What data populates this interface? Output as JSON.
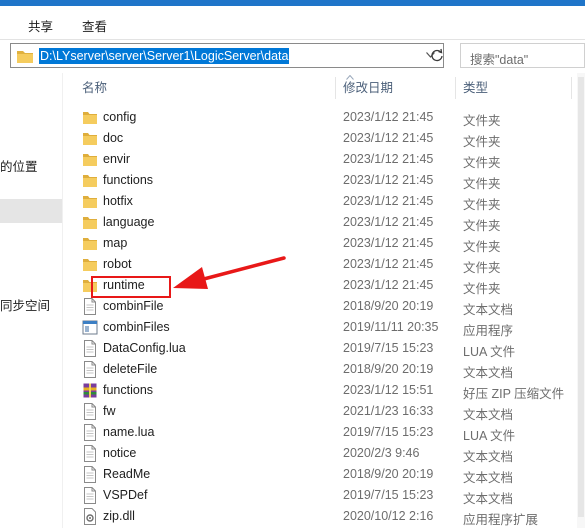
{
  "ribbon": {
    "tabs": [
      "共享",
      "查看"
    ]
  },
  "address": {
    "path": "D:\\LYserver\\server\\Server1\\LogicServer\\data"
  },
  "search": {
    "placeholder": "搜索\"data\""
  },
  "nav": {
    "items": [
      "的位置",
      "同步空间"
    ]
  },
  "columns": {
    "name": "名称",
    "date": "修改日期",
    "type": "类型"
  },
  "files": [
    {
      "name": "config",
      "date": "2023/1/12 21:45",
      "type": "文件夹",
      "icon": "folder-icon"
    },
    {
      "name": "doc",
      "date": "2023/1/12 21:45",
      "type": "文件夹",
      "icon": "folder-icon"
    },
    {
      "name": "envir",
      "date": "2023/1/12 21:45",
      "type": "文件夹",
      "icon": "folder-icon"
    },
    {
      "name": "functions",
      "date": "2023/1/12 21:45",
      "type": "文件夹",
      "icon": "folder-icon"
    },
    {
      "name": "hotfix",
      "date": "2023/1/12 21:45",
      "type": "文件夹",
      "icon": "folder-icon"
    },
    {
      "name": "language",
      "date": "2023/1/12 21:45",
      "type": "文件夹",
      "icon": "folder-icon"
    },
    {
      "name": "map",
      "date": "2023/1/12 21:45",
      "type": "文件夹",
      "icon": "folder-icon"
    },
    {
      "name": "robot",
      "date": "2023/1/12 21:45",
      "type": "文件夹",
      "icon": "folder-icon"
    },
    {
      "name": "runtime",
      "date": "2023/1/12 21:45",
      "type": "文件夹",
      "icon": "folder-icon"
    },
    {
      "name": "combinFile",
      "date": "2018/9/20 20:19",
      "type": "文本文档",
      "icon": "file-icon"
    },
    {
      "name": "combinFiles",
      "date": "2019/11/11 20:35",
      "type": "应用程序",
      "icon": "application-icon"
    },
    {
      "name": "DataConfig.lua",
      "date": "2019/7/15 15:23",
      "type": "LUA 文件",
      "icon": "file-icon"
    },
    {
      "name": "deleteFile",
      "date": "2018/9/20 20:19",
      "type": "文本文档",
      "icon": "file-icon"
    },
    {
      "name": "functions",
      "date": "2023/1/12 15:51",
      "type": "好压 ZIP 压缩文件",
      "icon": "zip-archive-icon"
    },
    {
      "name": "fw",
      "date": "2021/1/23 16:33",
      "type": "文本文档",
      "icon": "file-icon"
    },
    {
      "name": "name.lua",
      "date": "2019/7/15 15:23",
      "type": "LUA 文件",
      "icon": "file-icon"
    },
    {
      "name": "notice",
      "date": "2020/2/3 9:46",
      "type": "文本文档",
      "icon": "file-icon"
    },
    {
      "name": "ReadMe",
      "date": "2018/9/20 20:19",
      "type": "文本文档",
      "icon": "file-icon"
    },
    {
      "name": "VSPDef",
      "date": "2019/7/15 15:23",
      "type": "文本文档",
      "icon": "file-icon"
    },
    {
      "name": "zip.dll",
      "date": "2020/10/12 2:16",
      "type": "应用程序扩展",
      "icon": "dll-file-icon"
    }
  ],
  "colors": {
    "accent": "#0078d7",
    "folder": "#f2c75c",
    "annotation": "#e81818"
  }
}
